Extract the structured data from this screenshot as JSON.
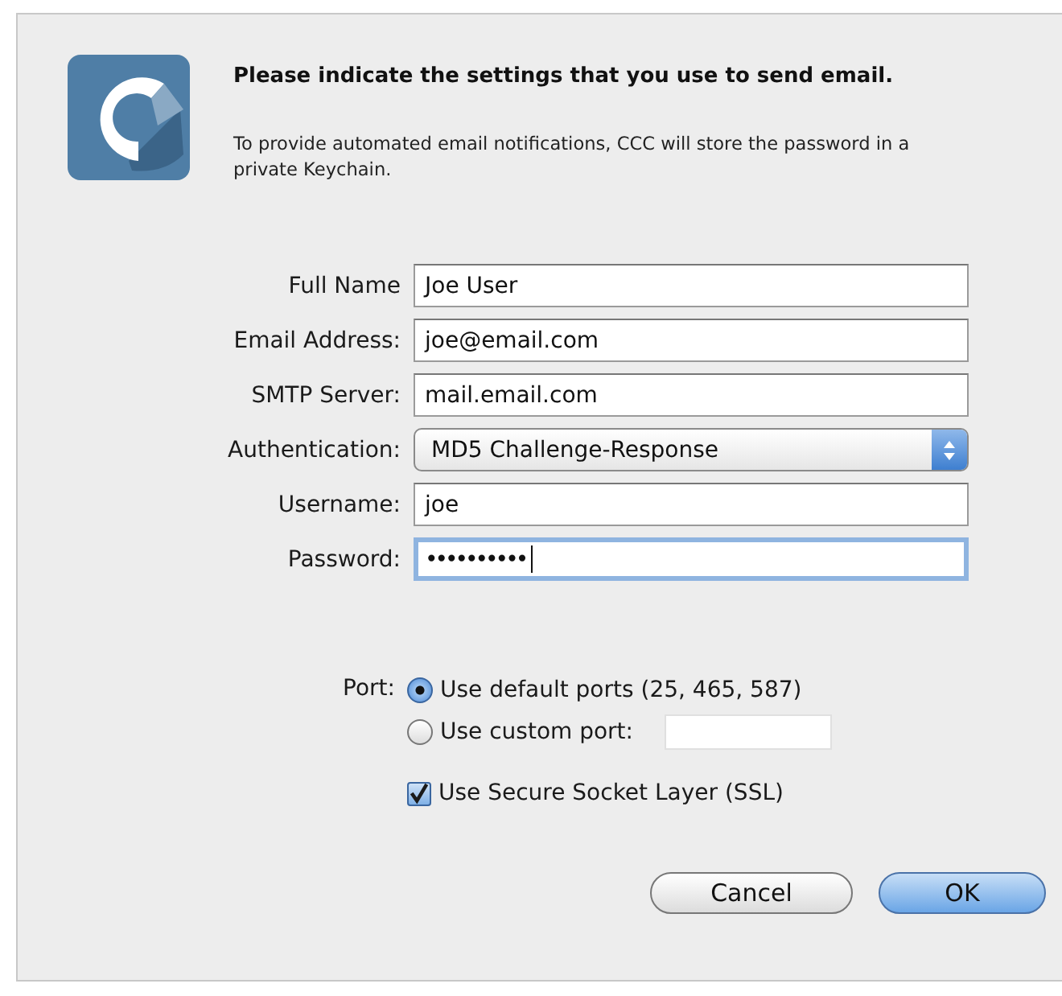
{
  "header": {
    "title": "Please indicate the settings that you use to send email.",
    "description": "To provide automated email notifications, CCC will store the password in a private Keychain."
  },
  "fields": [
    {
      "label": "Full Name",
      "kind": "text",
      "value": "Joe User",
      "focused": false
    },
    {
      "label": "Email Address:",
      "kind": "text",
      "value": "joe@email.com",
      "focused": false
    },
    {
      "label": "SMTP Server:",
      "kind": "text",
      "value": "mail.email.com",
      "focused": false
    },
    {
      "label": "Authentication:",
      "kind": "popup",
      "value": "MD5 Challenge-Response",
      "focused": false
    },
    {
      "label": "Username:",
      "kind": "text",
      "value": "joe",
      "focused": false
    },
    {
      "label": "Password:",
      "kind": "password",
      "value": "••••••••••",
      "focused": true
    }
  ],
  "port": {
    "label": "Port:",
    "options": [
      {
        "label": "Use default ports (25, 465, 587)",
        "selected": true,
        "kind": "plain"
      },
      {
        "label": "Use custom port:",
        "selected": false,
        "kind": "with_field"
      }
    ]
  },
  "ssl": {
    "label": "Use Secure Socket Layer (SSL)",
    "checked": true
  },
  "buttons": [
    {
      "label": "Cancel",
      "kind": "normal"
    },
    {
      "label": "OK",
      "kind": "default"
    }
  ]
}
